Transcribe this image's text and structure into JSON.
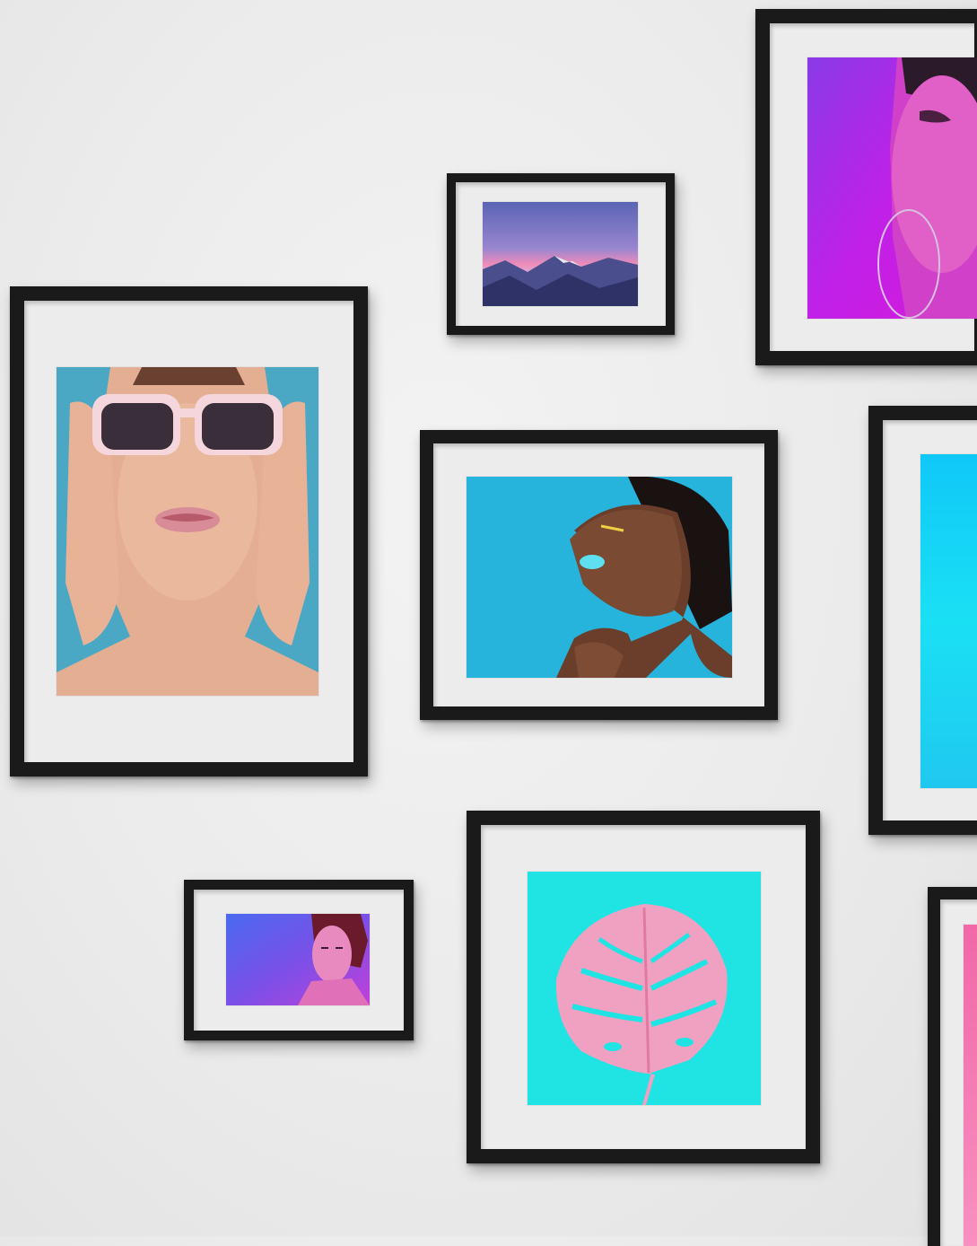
{
  "scene": {
    "wall_color": "#ececec",
    "frame_color": "#1a1a1a",
    "mat_color": "#ececec"
  },
  "frames": [
    {
      "id": "woman-sunglasses",
      "subject": "woman-in-pink-sunglasses-icon",
      "background": "#4aa8c4"
    },
    {
      "id": "mountain-sunset",
      "subject": "mountain-landscape-icon",
      "background": "#5a64b4"
    },
    {
      "id": "purple-portrait",
      "subject": "woman-purple-neon-icon",
      "background": "#b020e8"
    },
    {
      "id": "laughing-woman",
      "subject": "laughing-woman-icon",
      "background": "#26b4dc"
    },
    {
      "id": "cyan-abstract",
      "subject": "cyan-gradient-icon",
      "background": "#18d8f0"
    },
    {
      "id": "neon-portrait-small",
      "subject": "woman-neon-portrait-icon",
      "background": "#5a58e8"
    },
    {
      "id": "pink-leaf",
      "subject": "pink-monstera-leaf-icon",
      "background": "#20e4e4"
    },
    {
      "id": "pink-abstract",
      "subject": "pink-gradient-icon",
      "background": "#f078b0"
    }
  ]
}
